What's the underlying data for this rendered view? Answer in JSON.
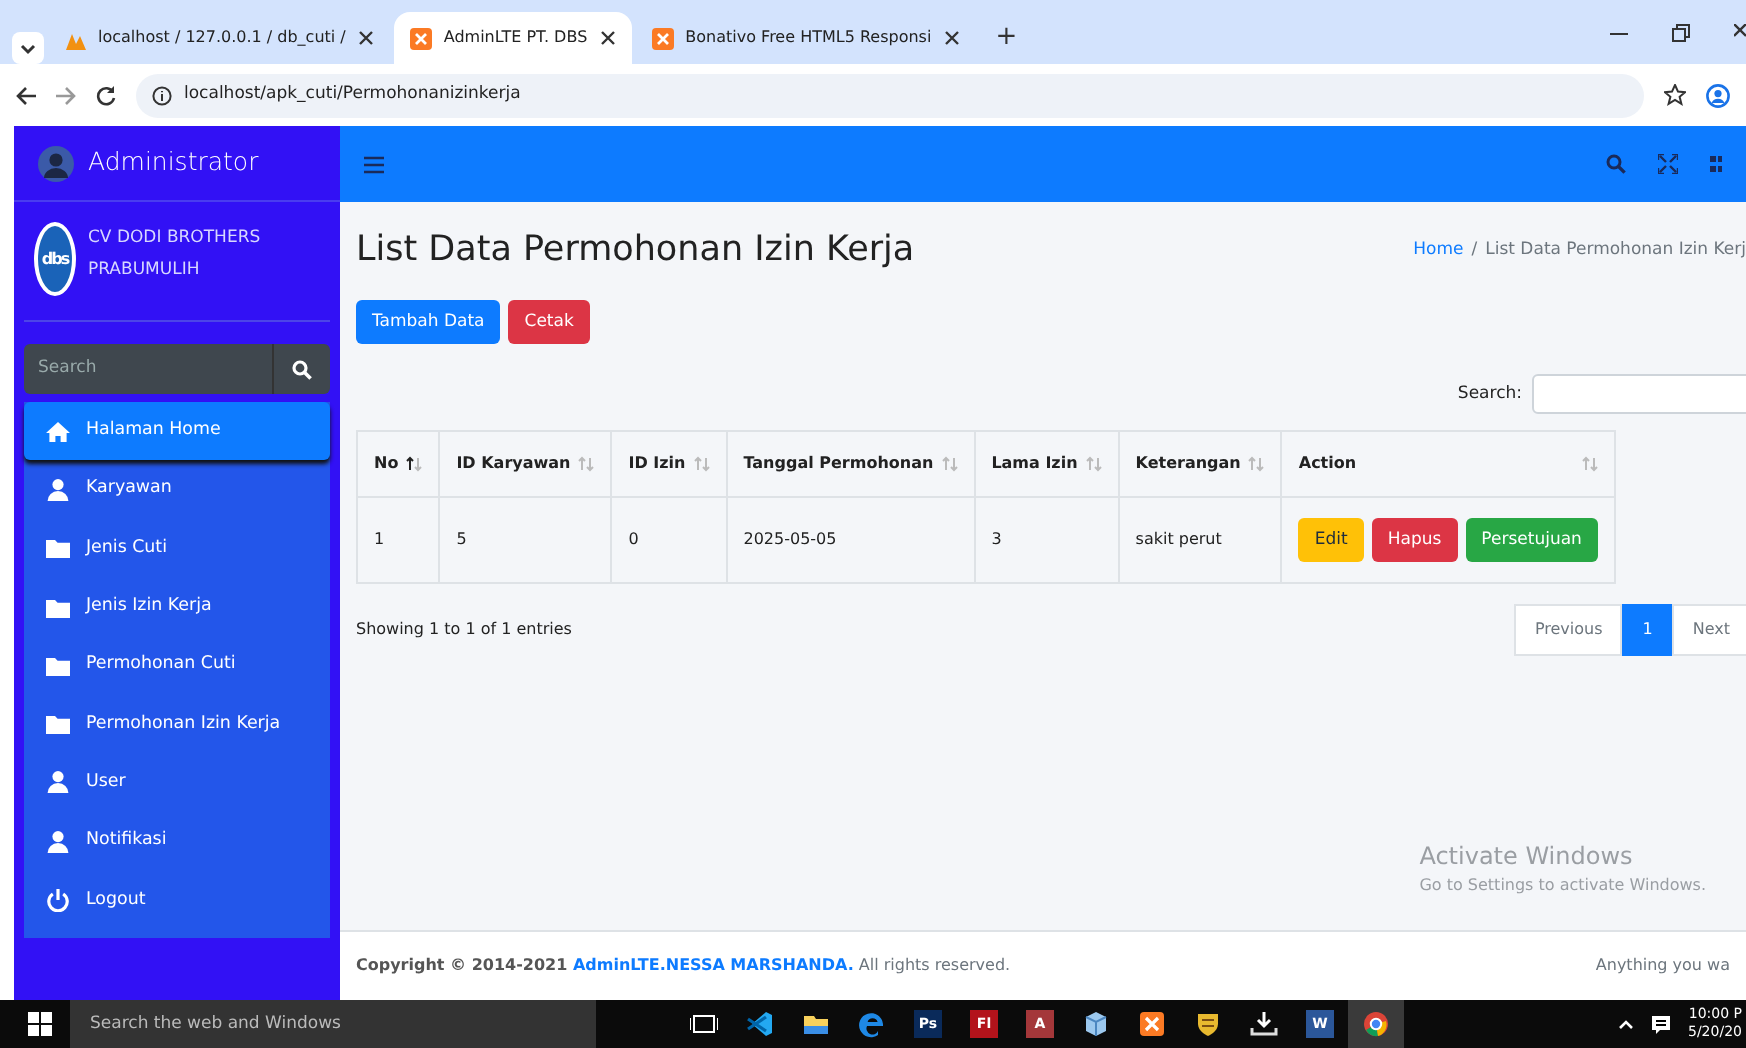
{
  "browser": {
    "tabs": [
      {
        "kind": "db",
        "title": "localhost / 127.0.0.1 / db_cuti /",
        "selected": false
      },
      {
        "kind": "xampp",
        "title": "AdminLTE PT. DBS",
        "selected": true
      },
      {
        "kind": "xampp",
        "title": "Bonativo Free HTML5 Responsi",
        "selected": false
      }
    ],
    "new_tab": "+",
    "url": "localhost/apk_cuti/Permohonanizinkerja"
  },
  "sidebar": {
    "brand": "Administrator",
    "company": "CV DODI BROTHERS PRABUMULIH",
    "logo_text": "dbs",
    "search_placeholder": "Search",
    "items": [
      {
        "kind": "home",
        "label": "Halaman Home",
        "selected": true
      },
      {
        "kind": "user",
        "label": "Karyawan",
        "selected": false
      },
      {
        "kind": "folder",
        "label": "Jenis Cuti",
        "selected": false
      },
      {
        "kind": "folder",
        "label": "Jenis Izin Kerja",
        "selected": false
      },
      {
        "kind": "folder",
        "label": "Permohonan Cuti",
        "selected": false
      },
      {
        "kind": "folder",
        "label": "Permohonan Izin Kerja",
        "selected": false
      },
      {
        "kind": "user",
        "label": "User",
        "selected": false
      },
      {
        "kind": "user",
        "label": "Notifikasi",
        "selected": false
      },
      {
        "kind": "power",
        "label": "Logout",
        "selected": false
      }
    ]
  },
  "page": {
    "title": "List Data Permohonan Izin Kerja",
    "breadcrumb": {
      "link": "Home",
      "separator": "/",
      "current": "List Data Permohonan Izin Kerj"
    },
    "buttons": [
      {
        "label": "Tambah Data",
        "kind": "primary"
      },
      {
        "label": "Cetak",
        "kind": "danger"
      }
    ],
    "search_label": "Search:",
    "table": {
      "columns": [
        {
          "label": "No",
          "sorted": true
        },
        {
          "label": "ID Karyawan",
          "sorted": false
        },
        {
          "label": "ID Izin",
          "sorted": false
        },
        {
          "label": "Tanggal Permohonan",
          "sorted": false
        },
        {
          "label": "Lama Izin",
          "sorted": false
        },
        {
          "label": "Keterangan",
          "sorted": false
        },
        {
          "label": "Action",
          "sorted": false
        }
      ],
      "rows": [
        {
          "cells": [
            "1",
            "5",
            "0",
            "2025-05-05",
            "3",
            "sakit perut"
          ],
          "actions": [
            {
              "label": "Edit",
              "kind": "warning"
            },
            {
              "label": "Hapus",
              "kind": "danger"
            },
            {
              "label": "Persetujuan",
              "kind": "success"
            }
          ]
        }
      ]
    },
    "info": "Showing 1 to 1 of 1 entries",
    "pagination": [
      {
        "label": "Previous",
        "selected": false
      },
      {
        "label": "1",
        "selected": true
      },
      {
        "label": "Next",
        "selected": false
      }
    ],
    "footer": {
      "prefix": "Copyright © 2014-2021 ",
      "link": "AdminLTE.NESSA MARSHANDA.",
      "suffix": " All rights reserved.",
      "right": "Anything you wa"
    }
  },
  "activation": {
    "title": "Activate Windows",
    "subtitle": "Go to Settings to activate Windows."
  },
  "taskbar": {
    "search_placeholder": "Search the web and Windows",
    "apps": [
      {
        "kind": "taskview"
      },
      {
        "kind": "code"
      },
      {
        "kind": "explorer"
      },
      {
        "kind": "edge"
      },
      {
        "kind": "tile",
        "label": "Ps",
        "color": "#0a2a5a"
      },
      {
        "kind": "tile",
        "label": "Fl",
        "color": "#b3131b"
      },
      {
        "kind": "tile",
        "label": "A",
        "color": "#a4373a"
      },
      {
        "kind": "cube"
      },
      {
        "kind": "xampp"
      },
      {
        "kind": "badge"
      },
      {
        "kind": "download"
      },
      {
        "kind": "tile",
        "label": "W",
        "color": "#2b579a"
      },
      {
        "kind": "chrome"
      }
    ],
    "time": "10:00 P",
    "date": "5/20/20"
  }
}
